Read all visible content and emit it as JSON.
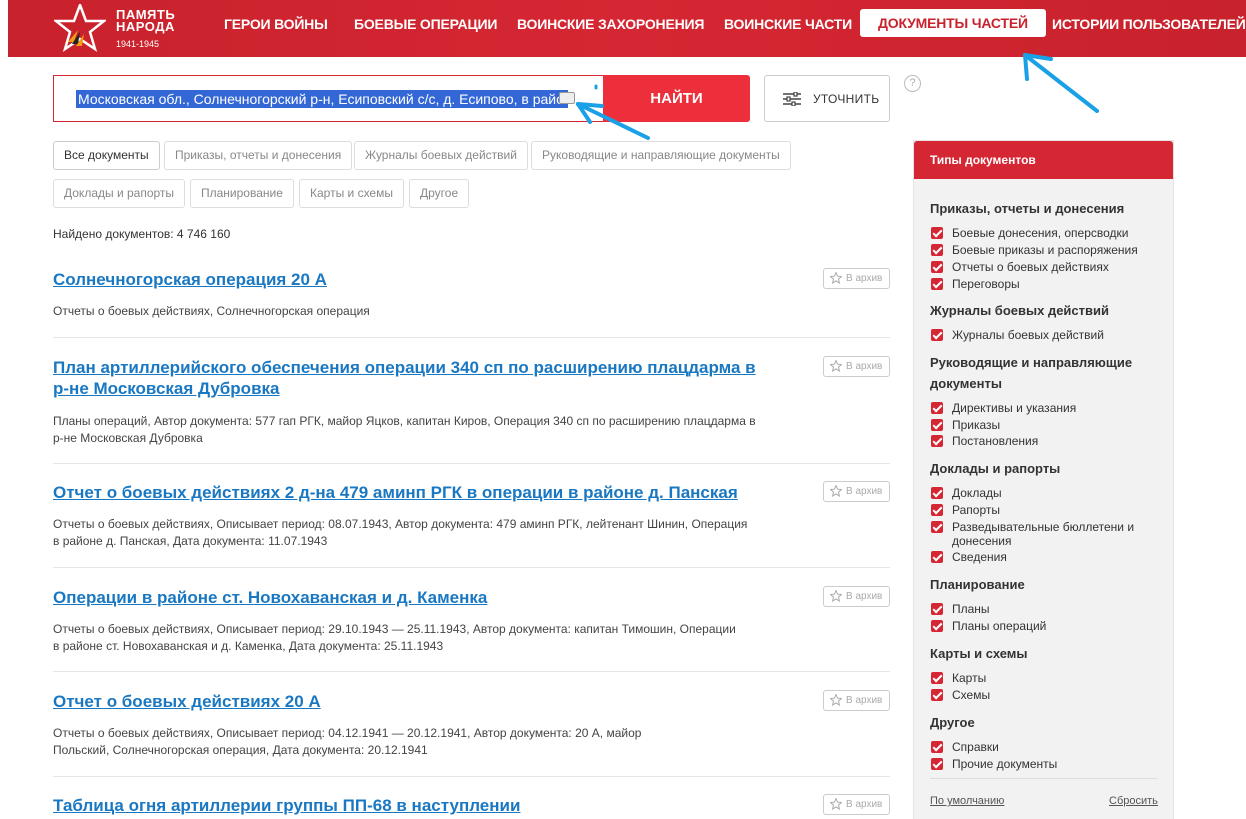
{
  "header": {
    "logo_line1": "ПАМЯТЬ",
    "logo_line2": "НАРОДА",
    "logo_years": "1941-1945",
    "nav": [
      {
        "label": "ГЕРОИ ВОЙНЫ",
        "active": false
      },
      {
        "label": "БОЕВЫЕ ОПЕРАЦИИ",
        "active": false
      },
      {
        "label": "ВОИНСКИЕ ЗАХОРОНЕНИЯ",
        "active": false
      },
      {
        "label": "ВОИНСКИЕ ЧАСТИ",
        "active": false
      },
      {
        "label": "ДОКУМЕНТЫ ЧАСТЕЙ",
        "active": true
      },
      {
        "label": "ИСТОРИИ ПОЛЬЗОВАТЕЛЕЙ",
        "active": false
      }
    ],
    "colors": {
      "brand": "#c8222c",
      "accent": "#ed2f3b",
      "link": "#1a78c2"
    }
  },
  "search": {
    "value": "Московская обл., Солнечногорский р-н, Есиповский с/с, д. Есипово, в районе",
    "find_label": "НАЙТИ",
    "refine_label": "УТОЧНИТЬ",
    "help_label": "?"
  },
  "filters": [
    {
      "label": "Все документы",
      "active": true
    },
    {
      "label": "Приказы, отчеты и донесения",
      "active": false
    },
    {
      "label": "Журналы боевых действий",
      "active": false
    },
    {
      "label": "Руководящие и направляющие документы",
      "active": false
    },
    {
      "label": "Доклады и рапорты",
      "active": false
    },
    {
      "label": "Планирование",
      "active": false
    },
    {
      "label": "Карты и схемы",
      "active": false
    },
    {
      "label": "Другое",
      "active": false
    }
  ],
  "found_text": "Найдено документов: 4 746 160",
  "archive_label": "В архив",
  "results": [
    {
      "title": "Солнечногорская операция 20 А",
      "desc": "Отчеты о боевых действиях, Солнечногорская операция"
    },
    {
      "title": "План артиллерийского обеспечения операции 340 сп по расширению плацдарма в р-не Московская Дубровка",
      "desc": "Планы операций, Автор документа: 577 гап РГК, майор Яцков, капитан Киров, Операция 340 сп по расширению плацдарма в р-не Московская Дубровка"
    },
    {
      "title": "Отчет о боевых действиях 2 д-на 479 аминп РГК в операции в районе д. Панская",
      "desc": "Отчеты о боевых действиях, Описывает период: 08.07.1943, Автор документа: 479 аминп РГК, лейтенант Шинин, Операция в районе д. Панская, Дата документа: 11.07.1943"
    },
    {
      "title": "Операции в районе ст. Новохаванская и д. Каменка",
      "desc": "Отчеты о боевых действиях, Описывает период: 29.10.1943 — 25.11.1943, Автор документа: капитан Тимошин, Операции в районе ст. Новохаванская и д. Каменка, Дата документа: 25.11.1943"
    },
    {
      "title": "Отчет о боевых действиях 20 А",
      "desc": "Отчеты о боевых действиях, Описывает период: 04.12.1941 — 20.12.1941, Автор документа: 20 А, майор Польский, Солнечногорская операция, Дата документа: 20.12.1941"
    },
    {
      "title": "Таблица огня артиллерии группы ПП-68 в наступлении",
      "desc": ""
    }
  ],
  "sidebar": {
    "title": "Типы документов",
    "groups": [
      {
        "title": "Приказы, отчеты и донесения",
        "items": [
          "Боевые донесения, оперсводки",
          "Боевые приказы и распоряжения",
          "Отчеты о боевых действиях",
          "Переговоры"
        ]
      },
      {
        "title": "Журналы боевых действий",
        "items": [
          "Журналы боевых действий"
        ]
      },
      {
        "title": "Руководящие и направляющие документы",
        "items": [
          "Директивы и указания",
          "Приказы",
          "Постановления"
        ]
      },
      {
        "title": "Доклады и рапорты",
        "items": [
          "Доклады",
          "Рапорты",
          "Разведывательные бюллетени и донесения",
          "Сведения"
        ]
      },
      {
        "title": "Планирование",
        "items": [
          "Планы",
          "Планы операций"
        ]
      },
      {
        "title": "Карты и схемы",
        "items": [
          "Карты",
          "Схемы"
        ]
      },
      {
        "title": "Другое",
        "items": [
          "Справки",
          "Прочие документы"
        ]
      }
    ],
    "default_link": "По умолчанию",
    "reset_link": "Сбросить"
  }
}
